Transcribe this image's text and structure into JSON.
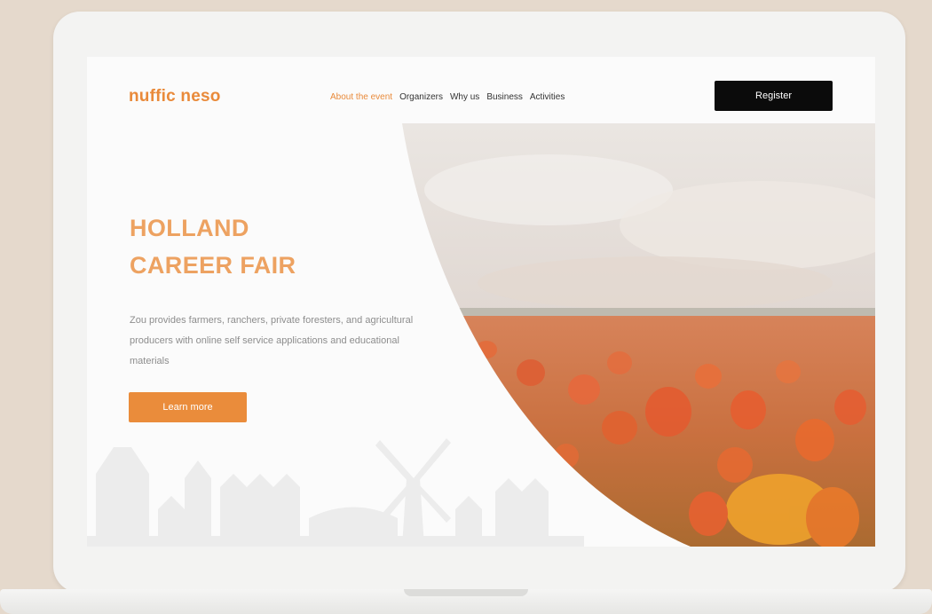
{
  "colors": {
    "accent": "#ea8c3b",
    "register_bg": "#0b0b0b",
    "background": "#e5d9cc"
  },
  "brand": {
    "logo_text": "nuffic neso"
  },
  "nav": {
    "items": [
      {
        "label": "About the event",
        "active": true
      },
      {
        "label": "Organizers",
        "active": false
      },
      {
        "label": "Why us",
        "active": false
      },
      {
        "label": "Business",
        "active": false
      },
      {
        "label": "Activities",
        "active": false
      }
    ],
    "register_label": "Register"
  },
  "hero": {
    "title_line1": "HOLLAND",
    "title_line2": "CAREER FAIR",
    "description": "Zou provides farmers, ranchers, private foresters, and agricultural producers with online self service applications and educational materials",
    "learn_more_label": "Learn more",
    "image": "tulip-field-photo",
    "decoration": "dutch-skyline-silhouette"
  }
}
